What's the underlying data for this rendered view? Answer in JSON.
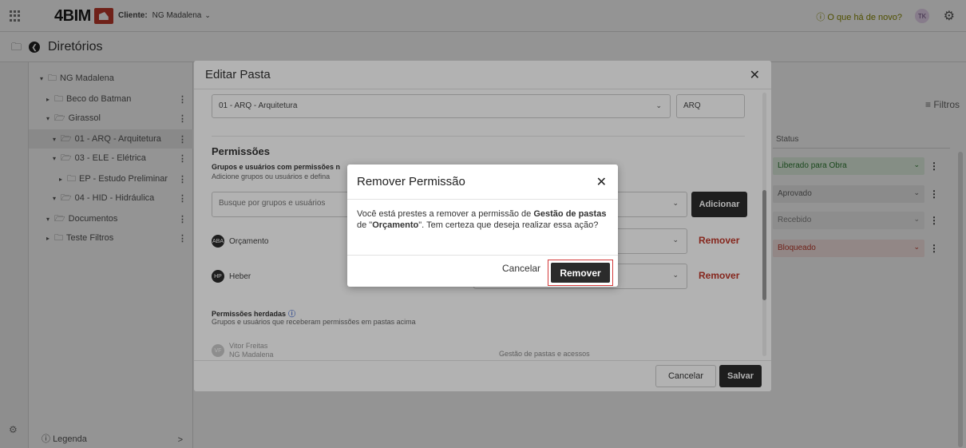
{
  "topbar": {
    "logo_text": "4BIM",
    "client_label": "Cliente:",
    "client_value": "NG Madalena",
    "whats_new": "O que há de novo?",
    "user_initials": "TK"
  },
  "dirbar": {
    "title": "Diretórios"
  },
  "tree": {
    "items": [
      {
        "label": "NG Madalena"
      },
      {
        "label": "Beco do Batman"
      },
      {
        "label": "Girassol"
      },
      {
        "label": "01 - ARQ - Arquitetura"
      },
      {
        "label": "03 - ELE - Elétrica"
      },
      {
        "label": "EP - Estudo Preliminar"
      },
      {
        "label": "04 - HID - Hidráulica"
      },
      {
        "label": "Documentos"
      },
      {
        "label": "Teste Filtros"
      }
    ],
    "legend": "Legenda"
  },
  "main": {
    "filters": "Filtros",
    "status_header": "Status",
    "statuses": [
      {
        "label": "Liberado para Obra",
        "color": "#2e7d32"
      },
      {
        "label": "Aprovado",
        "color": "#666666"
      },
      {
        "label": "Recebido",
        "color": "#888888"
      },
      {
        "label": "Bloqueado",
        "color": "#c0392b"
      }
    ]
  },
  "edit_modal": {
    "title": "Editar Pasta",
    "discipline_select": "01 - ARQ - Arquitetura",
    "abbrev_value": "ARQ",
    "permissions_title": "Permissões",
    "groups_title": "Grupos e usuários com permissões n",
    "groups_sub": "Adicione grupos ou usuários e defina",
    "search_placeholder": "Busque por grupos e usuários",
    "add_button": "Adicionar",
    "rows": [
      {
        "name": "Orçamento",
        "avatar": "ABA",
        "remove": "Remover"
      },
      {
        "name": "Heber",
        "avatar": "HP",
        "remove": "Remover"
      }
    ],
    "inherited_title": "Permissões herdadas",
    "inherited_sub": "Grupos e usuários que receberam permissões em pastas acima",
    "inherited_user": "Vitor Freitas",
    "inherited_user_sub": "NG Madalena",
    "inherited_user_avatar": "VF",
    "inherited_perm": "Gestão de pastas e acessos",
    "cancel": "Cancelar",
    "save": "Salvar"
  },
  "confirm": {
    "title": "Remover Permissão",
    "msg_1": "Você está prestes a remover a permissão de ",
    "msg_perm": "Gestão de pastas",
    "msg_2": " de \"",
    "msg_group": "Orçamento",
    "msg_3": "\". Tem certeza que deseja realizar essa ação?",
    "cancel": "Cancelar",
    "remove": "Remover"
  }
}
